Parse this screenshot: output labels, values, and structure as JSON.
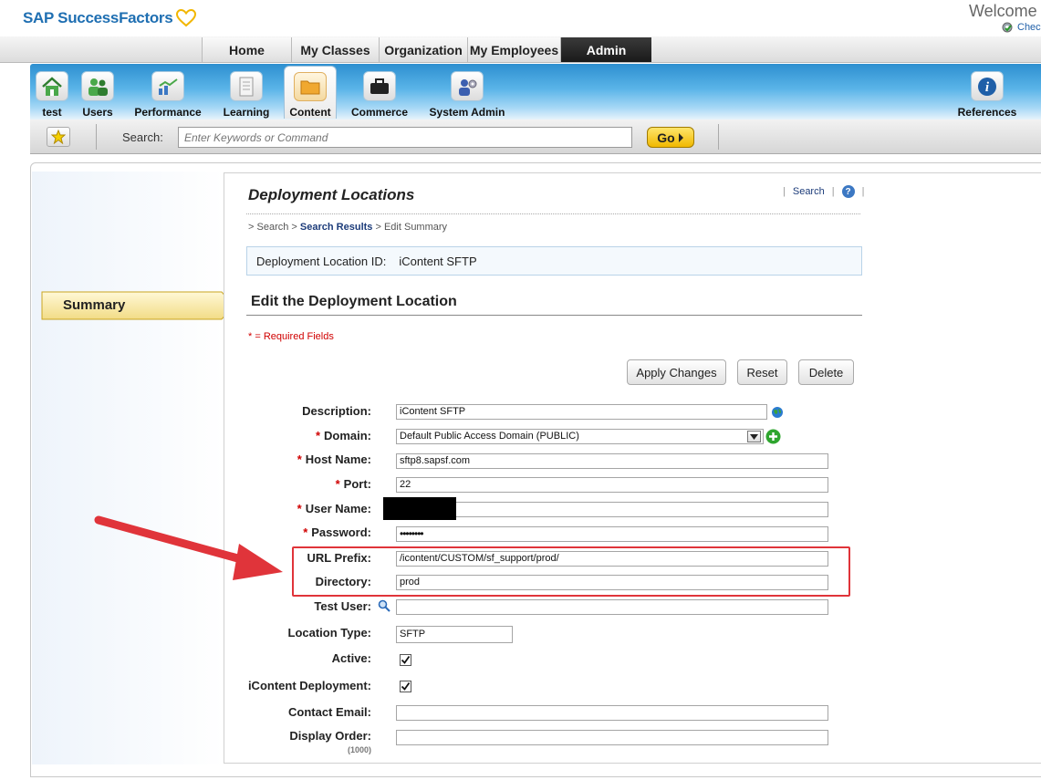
{
  "header": {
    "brand": "SAP SuccessFactors",
    "welcome": "Welcome",
    "check_link": "Chec"
  },
  "top_tabs": [
    {
      "label": "Home"
    },
    {
      "label": "My Classes"
    },
    {
      "label": "Organization"
    },
    {
      "label": "My Employees"
    },
    {
      "label": "Admin",
      "active": true
    }
  ],
  "modules": [
    {
      "label": "test",
      "icon": "house-icon"
    },
    {
      "label": "Users",
      "icon": "users-icon"
    },
    {
      "label": "Performance",
      "icon": "chart-icon"
    },
    {
      "label": "Learning",
      "icon": "document-icon"
    },
    {
      "label": "Content",
      "icon": "folder-icon",
      "selected": true
    },
    {
      "label": "Commerce",
      "icon": "briefcase-icon"
    },
    {
      "label": "System Admin",
      "icon": "gear-user-icon"
    },
    {
      "label": "References",
      "icon": "info-icon"
    }
  ],
  "search": {
    "label": "Search:",
    "placeholder": "Enter Keywords or Command",
    "go_label": "Go"
  },
  "sidebar": {
    "summary_label": "Summary"
  },
  "page": {
    "title": "Deployment Locations",
    "search_link": "Search",
    "breadcrumb": {
      "sep": ">",
      "search": "Search",
      "results": "Search Results",
      "current": "Edit Summary"
    },
    "id_label": "Deployment Location ID:",
    "id_value": "iContent SFTP",
    "edit_heading": "Edit the Deployment Location",
    "required_note": "* = Required Fields"
  },
  "buttons": {
    "apply": "Apply Changes",
    "reset": "Reset",
    "delete": "Delete"
  },
  "form": {
    "description": {
      "label": "Description:",
      "value": "iContent SFTP"
    },
    "domain": {
      "label": "Domain:",
      "value": "Default Public Access Domain (PUBLIC)"
    },
    "host_name": {
      "label": "Host Name:",
      "value": "sftp8.sapsf.com"
    },
    "port": {
      "label": "Port:",
      "value": "22"
    },
    "user_name": {
      "label": "User Name:",
      "value": ""
    },
    "password": {
      "label": "Password:",
      "value": "••••••••"
    },
    "url_prefix": {
      "label": "URL Prefix:",
      "value": "/icontent/CUSTOM/sf_support/prod/"
    },
    "directory": {
      "label": "Directory:",
      "value": "prod"
    },
    "test_user": {
      "label": "Test User:",
      "value": ""
    },
    "location_type": {
      "label": "Location Type:",
      "value": "SFTP"
    },
    "active": {
      "label": "Active:",
      "checked": true
    },
    "icontent_deployment": {
      "label": "iContent Deployment:",
      "checked": true
    },
    "contact_email": {
      "label": "Contact Email:",
      "value": ""
    },
    "display_order": {
      "label": "Display Order:",
      "value": "",
      "hint": "(1000)"
    },
    "required_mark": "*"
  },
  "colors": {
    "brand_blue": "#1f6fb2",
    "required_red": "#d00000",
    "annotation_red": "#e0343a",
    "go_yellow": "#f0b800"
  }
}
